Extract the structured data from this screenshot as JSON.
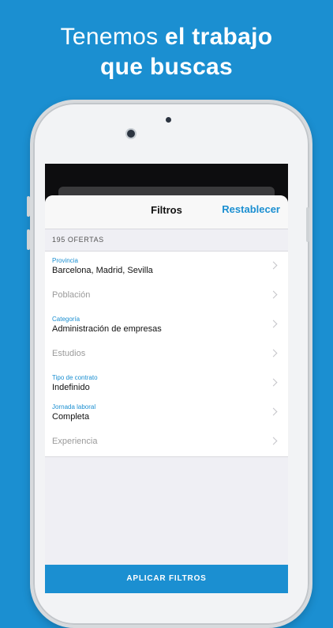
{
  "headline": {
    "line1_light": "Tenemos ",
    "line1_bold": "el trabajo",
    "line2_bold": "que buscas"
  },
  "screen": {
    "title": "Filtros",
    "reset_label": "Restablecer",
    "results_count": "195 OFERTAS",
    "filters": [
      {
        "caption": "Provincia",
        "value": "Barcelona, Madrid, Sevilla"
      },
      {
        "caption": "",
        "placeholder": "Población"
      },
      {
        "caption": "Categoría",
        "value": "Administración de empresas"
      },
      {
        "caption": "",
        "placeholder": "Estudios"
      },
      {
        "caption": "Tipo de contrato",
        "value": "Indefinido"
      },
      {
        "caption": "Jornada laboral",
        "value": "Completa"
      },
      {
        "caption": "",
        "placeholder": "Experiencia"
      }
    ],
    "apply_label": "APLICAR FILTROS"
  },
  "colors": {
    "background": "#1b8fd1",
    "accent": "#1b8fd1"
  },
  "icons": {
    "row_disclosure": "chevron-right-icon"
  }
}
